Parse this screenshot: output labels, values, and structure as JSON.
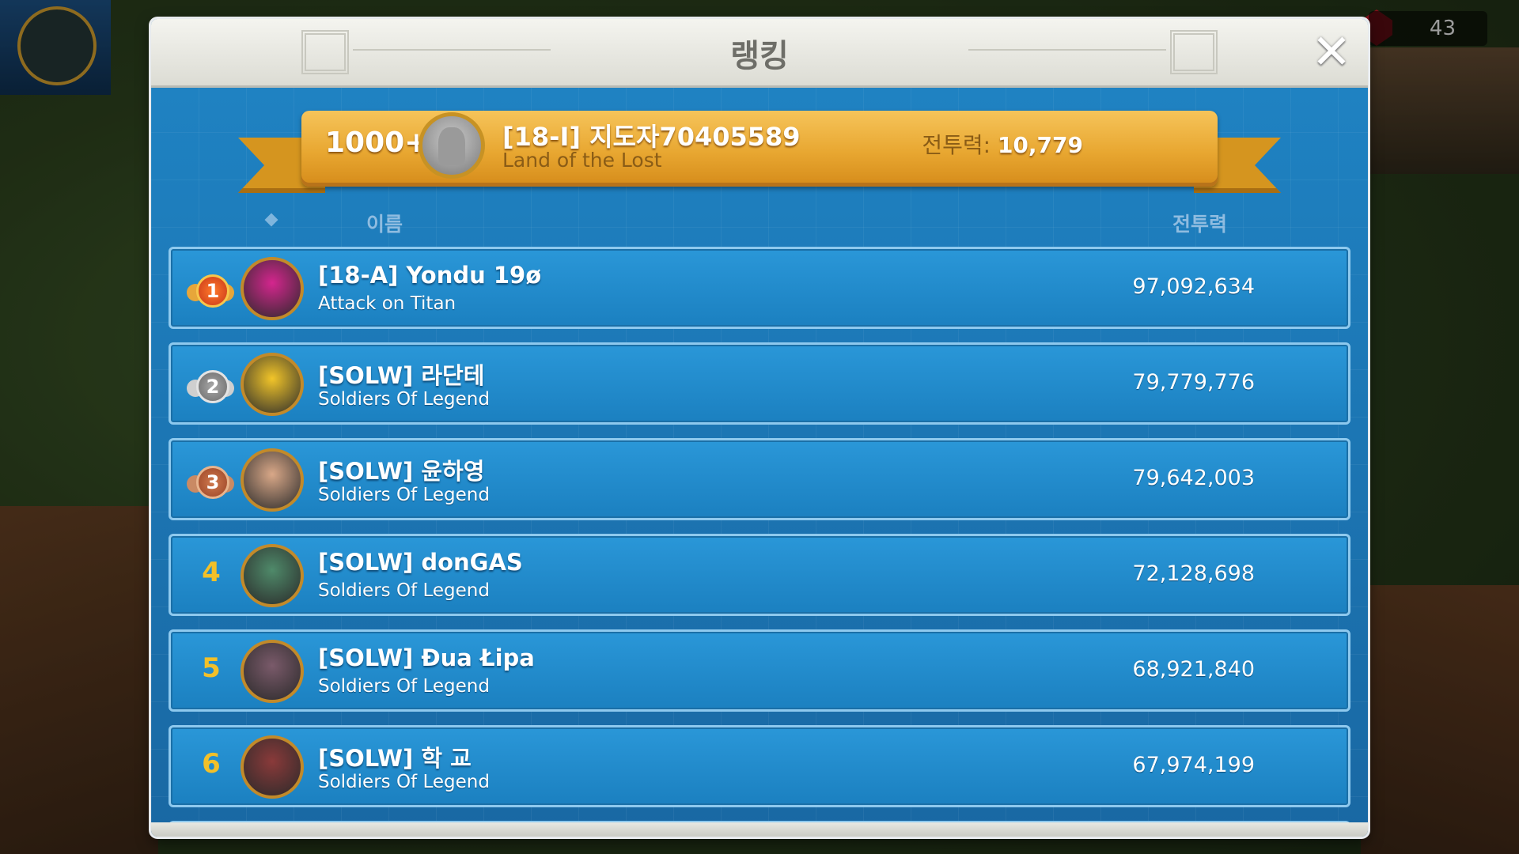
{
  "background": {
    "counter_value": "43"
  },
  "dialog": {
    "title": "랭킹",
    "close_icon": "close-icon"
  },
  "my_entry": {
    "rank": "1000+",
    "name": "[18-I] 지도자70405589",
    "guild": "Land of the Lost",
    "power_label": "전투력:",
    "power_value": "10,779"
  },
  "columns": {
    "name": "이름",
    "power": "전투력"
  },
  "rankings": [
    {
      "rank": "1",
      "badge": "gold",
      "name": "[18-A] Yondu 19ø",
      "guild": "Attack on Titan",
      "power": "97,092,634",
      "avatar_color": "#d4268e"
    },
    {
      "rank": "2",
      "badge": "silver",
      "name": "[SOLW] 라단테",
      "guild": "Soldiers Of Legend",
      "power": "79,779,776",
      "avatar_color": "#f2c529"
    },
    {
      "rank": "3",
      "badge": "bronze",
      "name": "[SOLW] 윤하영",
      "guild": "Soldiers Of Legend",
      "power": "79,642,003",
      "avatar_color": "#d9a888"
    },
    {
      "rank": "4",
      "badge": "none",
      "name": "[SOLW] donGAS",
      "guild": "Soldiers Of Legend",
      "power": "72,128,698",
      "avatar_color": "#4f8a6a"
    },
    {
      "rank": "5",
      "badge": "none",
      "name": "[SOLW] Đua Łipa",
      "guild": "Soldiers Of Legend",
      "power": "68,921,840",
      "avatar_color": "#7a5a6a"
    },
    {
      "rank": "6",
      "badge": "none",
      "name": "[SOLW] 학 교",
      "guild": "Soldiers Of Legend",
      "power": "67,974,199",
      "avatar_color": "#8a3a3a"
    }
  ],
  "colors": {
    "panel": "#1d79b5",
    "ribbon": "#e8a731",
    "rank_number": "#f2c029"
  }
}
